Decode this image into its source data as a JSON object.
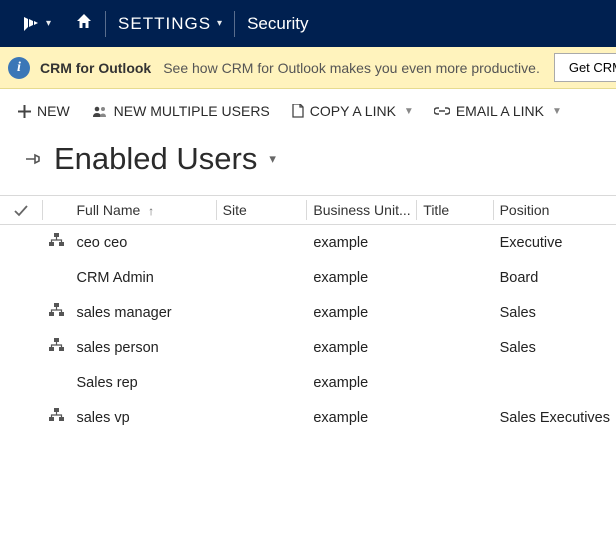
{
  "nav": {
    "settings_label": "SETTINGS",
    "breadcrumb": "Security"
  },
  "banner": {
    "title": "CRM for Outlook",
    "text": "See how CRM for Outlook makes you even more productive.",
    "button": "Get CRM for Outlook"
  },
  "toolbar": {
    "new": "NEW",
    "new_multiple": "NEW MULTIPLE USERS",
    "copy_link": "COPY A LINK",
    "email_link": "EMAIL A LINK"
  },
  "view": {
    "title": "Enabled Users"
  },
  "columns": {
    "full_name": "Full Name",
    "site": "Site",
    "business_unit": "Business Unit...",
    "title": "Title",
    "position": "Position"
  },
  "rows": [
    {
      "has_icon": true,
      "full_name": "ceo ceo",
      "site": "",
      "business_unit": "example",
      "title": "",
      "position": "Executive"
    },
    {
      "has_icon": false,
      "full_name": "CRM Admin",
      "site": "",
      "business_unit": "example",
      "title": "",
      "position": "Board"
    },
    {
      "has_icon": true,
      "full_name": "sales manager",
      "site": "",
      "business_unit": "example",
      "title": "",
      "position": "Sales"
    },
    {
      "has_icon": true,
      "full_name": "sales person",
      "site": "",
      "business_unit": "example",
      "title": "",
      "position": "Sales"
    },
    {
      "has_icon": false,
      "full_name": "Sales rep",
      "site": "",
      "business_unit": "example",
      "title": "",
      "position": ""
    },
    {
      "has_icon": true,
      "full_name": "sales vp",
      "site": "",
      "business_unit": "example",
      "title": "",
      "position": "Sales Executives"
    }
  ]
}
